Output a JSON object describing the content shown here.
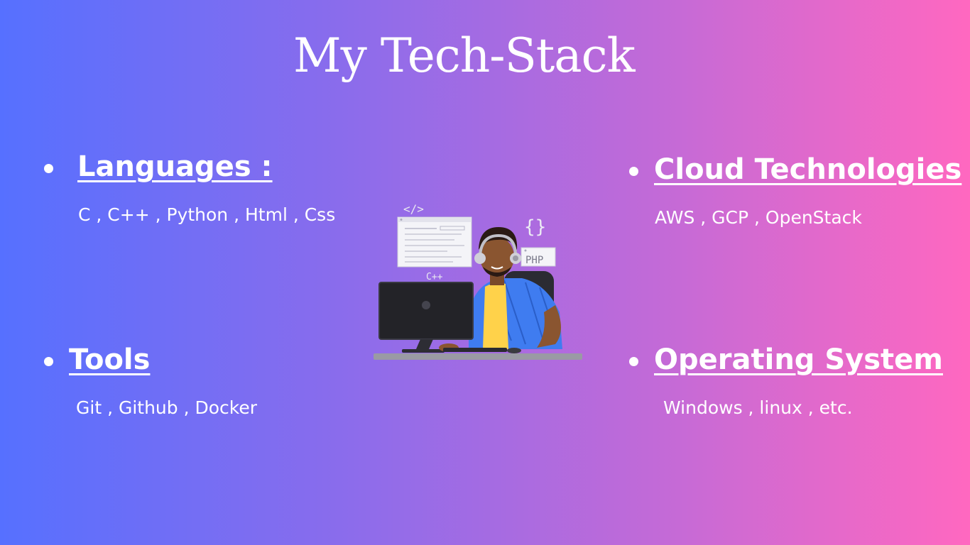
{
  "title": "My Tech-Stack",
  "sections": {
    "languages": {
      "heading": "Languages :",
      "items": "C , C++ , Python , Html , Css"
    },
    "cloud": {
      "heading": "Cloud Technologies ",
      "items": "AWS , GCP , OpenStack"
    },
    "tools": {
      "heading": "Tools",
      "items": "Git , Github , Docker"
    },
    "os": {
      "heading": "Operating System",
      "items": "Windows , linux , etc."
    }
  },
  "illustration": {
    "code_tag": "</>",
    "braces": "{}",
    "php_label": "PHP",
    "cpp_label": "C++"
  },
  "colors": {
    "gradient_left": "#5670ff",
    "gradient_right": "#ff68c0",
    "text": "#ffffff"
  }
}
